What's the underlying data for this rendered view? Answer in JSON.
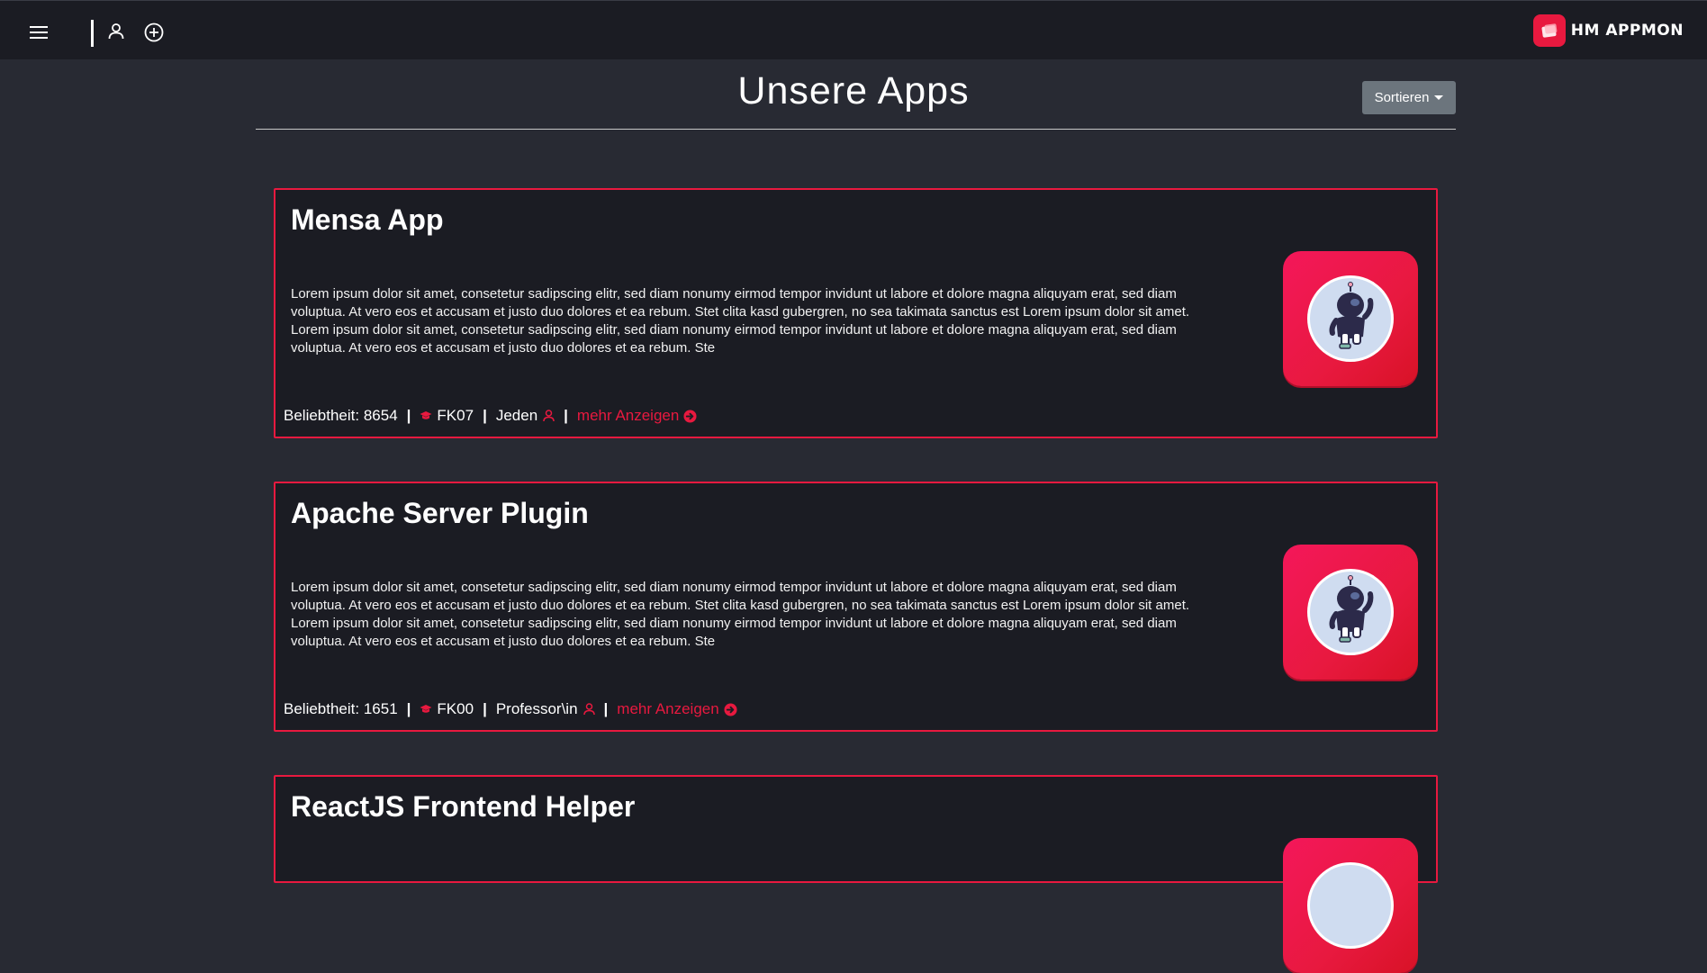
{
  "header": {
    "logo_text": "HM APPMON"
  },
  "page": {
    "title": "Unsere Apps",
    "sort_label": "Sortieren"
  },
  "apps": [
    {
      "name": "Mensa App",
      "description": "Lorem ipsum dolor sit amet, consetetur sadipscing elitr, sed diam nonumy eirmod tempor invidunt ut labore et dolore magna aliquyam erat, sed diam voluptua. At vero eos et accusam et justo duo dolores et ea rebum. Stet clita kasd gubergren, no sea takimata sanctus est Lorem ipsum dolor sit amet. Lorem ipsum dolor sit amet, consetetur sadipscing elitr, sed diam nonumy eirmod tempor invidunt ut labore et dolore magna aliquyam erat, sed diam voluptua. At vero eos et accusam et justo duo dolores et ea rebum. Ste",
      "popularity": "Beliebtheit: 8654",
      "faculty": "FK07",
      "audience": "Jeden",
      "more_label": "mehr Anzeigen"
    },
    {
      "name": "Apache Server Plugin",
      "description": "Lorem ipsum dolor sit amet, consetetur sadipscing elitr, sed diam nonumy eirmod tempor invidunt ut labore et dolore magna aliquyam erat, sed diam voluptua. At vero eos et accusam et justo duo dolores et ea rebum. Stet clita kasd gubergren, no sea takimata sanctus est Lorem ipsum dolor sit amet. Lorem ipsum dolor sit amet, consetetur sadipscing elitr, sed diam nonumy eirmod tempor invidunt ut labore et dolore magna aliquyam erat, sed diam voluptua. At vero eos et accusam et justo duo dolores et ea rebum. Ste",
      "popularity": "Beliebtheit: 1651",
      "faculty": "FK00",
      "audience": "Professor\\in",
      "more_label": "mehr Anzeigen"
    },
    {
      "name": "ReactJS Frontend Helper"
    }
  ],
  "colors": {
    "accent": "#e8193f",
    "background": "#282a33",
    "card": "#1b1c23",
    "button": "#6c757d"
  },
  "icons": [
    "hamburger-menu-icon",
    "user-icon",
    "plus-circle-icon",
    "graduation-cap-icon",
    "person-icon",
    "arrow-circle-right-icon",
    "astronaut-icon"
  ]
}
